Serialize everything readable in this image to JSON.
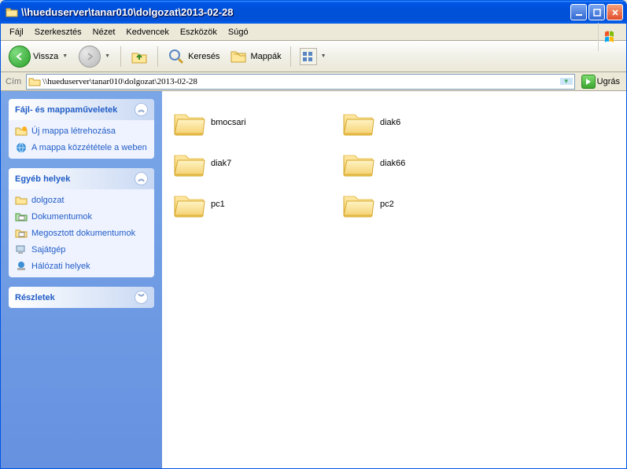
{
  "window": {
    "title": "\\\\hueduserver\\tanar010\\dolgozat\\2013-02-28"
  },
  "menubar": [
    "Fájl",
    "Szerkesztés",
    "Nézet",
    "Kedvencek",
    "Eszközök",
    "Súgó"
  ],
  "toolbar": {
    "back": "Vissza",
    "search": "Keresés",
    "folders": "Mappák"
  },
  "address": {
    "label": "Cím",
    "value": "\\\\hueduserver\\tanar010\\dolgozat\\2013-02-28",
    "go": "Ugrás"
  },
  "sidebar": {
    "tasks": {
      "title": "Fájl- és mappaműveletek",
      "items": [
        "Új mappa létrehozása",
        "A mappa közzététele a weben"
      ]
    },
    "places": {
      "title": "Egyéb helyek",
      "items": [
        "dolgozat",
        "Dokumentumok",
        "Megosztott dokumentumok",
        "Sajátgép",
        "Hálózati helyek"
      ]
    },
    "details": {
      "title": "Részletek"
    }
  },
  "content": {
    "folders": [
      "bmocsari",
      "diak6",
      "diak7",
      "diak66",
      "pc1",
      "pc2"
    ]
  }
}
